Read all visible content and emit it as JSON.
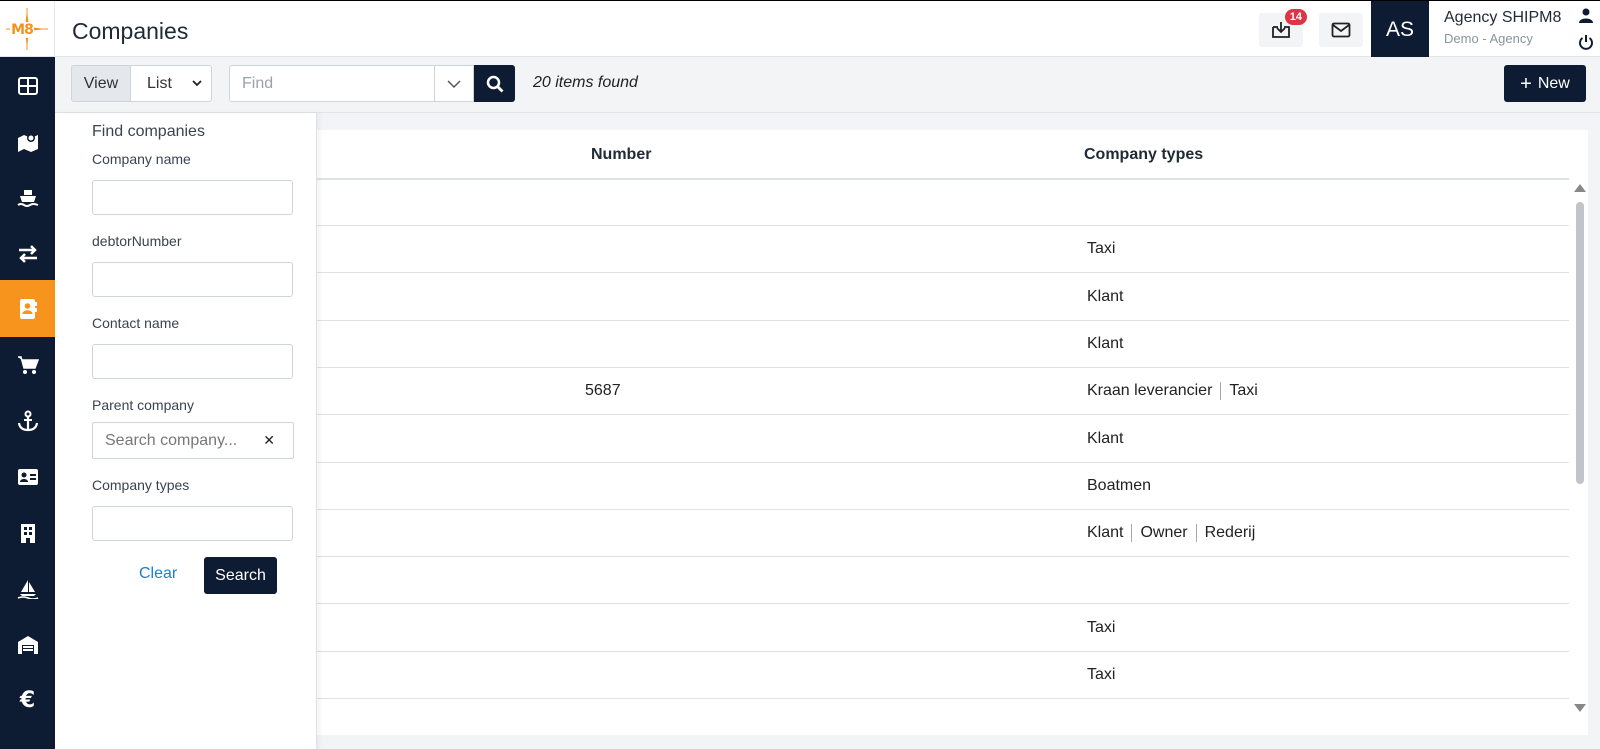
{
  "app": {
    "logo_text": "M8",
    "page_title": "Companies"
  },
  "header": {
    "download_badge": "14",
    "avatar_initials": "AS",
    "agency_name": "Agency SHIPM8",
    "agency_sub": "Demo - Agency"
  },
  "sidebar": {
    "items": [
      {
        "icon": "dashboard-grid-icon"
      },
      {
        "icon": "map-icon"
      },
      {
        "icon": "ship-icon"
      },
      {
        "icon": "exchange-arrows-icon"
      },
      {
        "icon": "address-book-icon",
        "active": true
      },
      {
        "icon": "shopping-cart-icon"
      },
      {
        "icon": "anchor-icon"
      },
      {
        "icon": "id-card-icon"
      },
      {
        "icon": "building-icon"
      },
      {
        "icon": "sailboat-icon"
      },
      {
        "icon": "warehouse-icon"
      },
      {
        "icon": "euro-icon"
      }
    ],
    "active_color": "#f7941d",
    "background": "#0d1b33"
  },
  "toolbar": {
    "view_label": "View",
    "view_value": "List",
    "find_placeholder": "Find",
    "items_found": "20 items found",
    "new_label": "New"
  },
  "find_panel": {
    "title": "Find companies",
    "company_name_label": "Company name",
    "debtor_label": "debtorNumber",
    "contact_label": "Contact name",
    "parent_label": "Parent company",
    "parent_placeholder": "Search company...",
    "types_label": "Company types",
    "clear_label": "Clear",
    "search_label": "Search"
  },
  "table": {
    "columns": [
      "Number",
      "Company types"
    ],
    "rows": [
      {
        "number": "",
        "types": []
      },
      {
        "number": "",
        "types": [
          "Taxi"
        ]
      },
      {
        "number": "",
        "types": [
          "Klant"
        ]
      },
      {
        "number": "",
        "types": [
          "Klant"
        ]
      },
      {
        "number": "5687",
        "types": [
          "Kraan leverancier",
          "Taxi"
        ]
      },
      {
        "number": "",
        "types": [
          "Klant"
        ]
      },
      {
        "number": "",
        "types": [
          "Boatmen"
        ]
      },
      {
        "number": "",
        "types": [
          "Klant",
          "Owner",
          "Rederij"
        ]
      },
      {
        "number": "",
        "types": []
      },
      {
        "number": "",
        "types": [
          "Taxi"
        ]
      },
      {
        "number": "",
        "types": [
          "Taxi"
        ]
      }
    ]
  }
}
